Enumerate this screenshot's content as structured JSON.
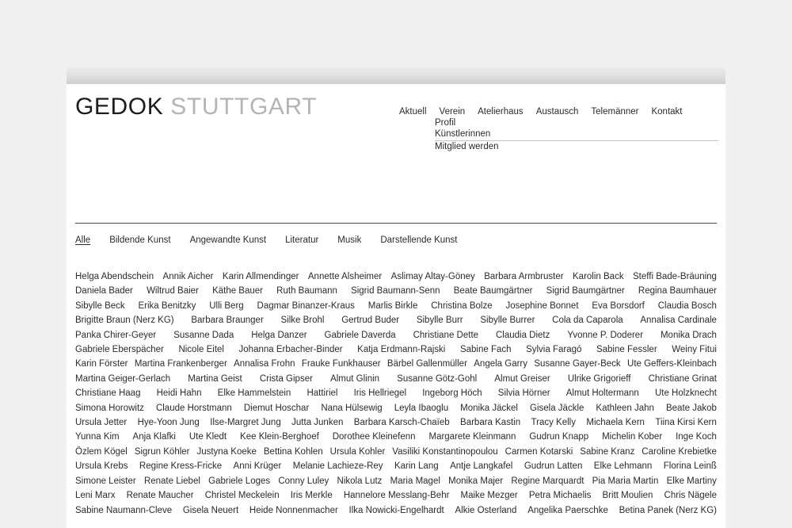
{
  "site": {
    "logo_primary": "GEDOK",
    "logo_secondary": "STUTTGART"
  },
  "nav": {
    "main": [
      {
        "label": "Aktuell"
      },
      {
        "label": "Verein"
      },
      {
        "label": "Atelierhaus"
      },
      {
        "label": "Austausch"
      },
      {
        "label": "Telemänner"
      },
      {
        "label": "Kontakt"
      }
    ],
    "sub": [
      {
        "label": "Profil"
      },
      {
        "label": "Künstlerinnen"
      },
      {
        "label": "Mitglied werden"
      }
    ]
  },
  "filters": {
    "active": "Alle",
    "items": [
      {
        "label": "Alle"
      },
      {
        "label": "Bildende Kunst"
      },
      {
        "label": "Angewandte Kunst"
      },
      {
        "label": "Literatur"
      },
      {
        "label": "Musik"
      },
      {
        "label": "Darstellende Kunst"
      }
    ]
  },
  "artists": {
    "rows": [
      [
        "Helga Abendschein",
        "Annik Aicher",
        "Karin Allmendinger",
        "Annette Alsheimer",
        "Aslimay Altay-Göney",
        "Barbara Armbruster",
        "Karolin Back",
        "Steffi Bade-Bräuning"
      ],
      [
        "Daniela Bader",
        "Wiltrud Baier",
        "Käthe Bauer",
        "Ruth Baumann",
        "Sigrid Baumann-Senn",
        "Beate Baumgärtner",
        "Sigrid Baumgärtner",
        "Regina Baumhauer"
      ],
      [
        "Sibylle Beck",
        "Erika Benitzky",
        "Ulli Berg",
        "Dagmar Binanzer-Kraus",
        "Marlis Birkle",
        "Christina Bolze",
        "Josephine Bonnet",
        "Eva Borsdorf",
        "Claudia Bosch"
      ],
      [
        "Brigitte Braun (Nerz KG)",
        "Barbara Braunger",
        "Silke Brohl",
        "Gertrud Buder",
        "Sibylle Burr",
        "Sibylle Burrer",
        "Cola da Caparola",
        "Annalisa Cardinale"
      ],
      [
        "Panka Chirer-Geyer",
        "Susanne Dada",
        "Helga Danzer",
        "Gabriele Daverda",
        "Christiane Dette",
        "Claudia Dietz",
        "Yvonne P. Doderer",
        "Monika Drach"
      ],
      [
        "Gabriele Eberspächer",
        "Nicole Eitel",
        "Johanna Erbacher-Binder",
        "Katja Erdmann-Rajski",
        "Sabine Fach",
        "Sylvia Faragó",
        "Sabine Fessler",
        "Weiny Fitui"
      ],
      [
        "Karin Förster",
        "Martina Frankenberger",
        "Annalisa Frohn",
        "Frauke Funkhauser",
        "Bärbel Gallenmüller",
        "Angela Garry",
        "Susanne Gayer-Beck",
        "Ute Geffers-Kleinbach"
      ],
      [
        "Martina Geiger-Gerlach",
        "Martina Geist",
        "Crista Gipser",
        "Almut Glinin",
        "Susanne Götz-Gohl",
        "Almut Greiser",
        "Ulrike Grigorieff",
        "Christiane Grinat"
      ],
      [
        "Christiane Haag",
        "Heidi Hahn",
        "Elke Hammelstein",
        "Hattiriel",
        "Iris Hellriegel",
        "Ingeborg Höch",
        "Silvia Hörner",
        "Almut Holtermann",
        "Ute Holzknecht"
      ],
      [
        "Simona Horowitz",
        "Claude Horstmann",
        "Diemut Hoschar",
        "Nana Hülsewig",
        "Leyla Ibaoglu",
        "Monika Jäckel",
        "Gisela Jäckle",
        "Kathleen Jahn",
        "Beate Jakob"
      ],
      [
        "Ursula Jetter",
        "Hye-Yoon Jung",
        "Ilse-Margret Jung",
        "Jutta Junken",
        "Barbara Karsch-Chaïeb",
        "Barbara Kastin",
        "Tracy Kelly",
        "Michaela Kern",
        "Tiina Kirsi Kern"
      ],
      [
        "Yunna Kim",
        "Anja Klafki",
        "Ute Kledt",
        "Kee Klein-Berghoef",
        "Dorothee Kleinefenn",
        "Margarete Kleinmann",
        "Gudrun Knapp",
        "Michelin Kober",
        "Inge Koch"
      ],
      [
        "Özlem Kögel",
        "Sigrun Köhler",
        "Justyna Koeke",
        "Bettina Kohlen",
        "Ursula Kohler",
        "Vasiliki Konstantinopoulou",
        "Carmen Kotarski",
        "Sabine Kranz",
        "Caroline Krebietke"
      ],
      [
        "Ursula Krebs",
        "Regine Kress-Fricke",
        "Anni Krüger",
        "Melanie Lachieze-Rey",
        "Karin Lang",
        "Antje Langkafel",
        "Gudrun Latten",
        "Elke Lehmann",
        "Florina Leinß"
      ],
      [
        "Simone Leister",
        "Renate Liebel",
        "Gabriele Loges",
        "Conny Luley",
        "Nikola Lutz",
        "Maria Magel",
        "Monika Majer",
        "Regine Marquardt",
        "Pia Maria Martin",
        "Elke Martiny"
      ],
      [
        "Leni Marx",
        "Renate Maucher",
        "Christel Meckelein",
        "Iris Merkle",
        "Hannelore Messlang-Behr",
        "Maike Mezger",
        "Petra Michaelis",
        "Britt Moulien",
        "Chris Nägele"
      ],
      [
        "Sabine Naumann-Cleve",
        "Gisela Neuert",
        "Heide Nonnenmacher",
        "Ilka Nowicki-Engelhardt",
        "Alkie Osterland",
        "Angelika Paerschke",
        "Betina Panek (Nerz KG)"
      ]
    ]
  }
}
